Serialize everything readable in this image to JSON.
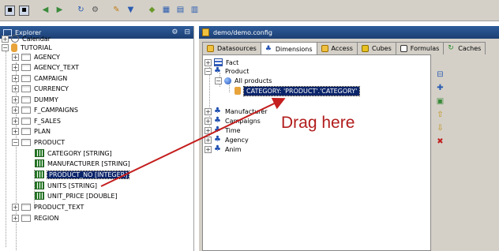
{
  "explorer": {
    "title": "Explorer",
    "tree": [
      {
        "label": "Calendar",
        "icon": "clock-icon"
      },
      {
        "label": "TUTORIAL",
        "icon": "database-icon"
      },
      {
        "label": "AGENCY",
        "icon": "table-icon"
      },
      {
        "label": "AGENCY_TEXT",
        "icon": "table-icon"
      },
      {
        "label": "CAMPAIGN",
        "icon": "table-icon"
      },
      {
        "label": "CURRENCY",
        "icon": "table-icon"
      },
      {
        "label": "DUMMY",
        "icon": "table-icon"
      },
      {
        "label": "F_CAMPAIGNS",
        "icon": "table-icon"
      },
      {
        "label": "F_SALES",
        "icon": "table-icon"
      },
      {
        "label": "PLAN",
        "icon": "table-icon"
      },
      {
        "label": "PRODUCT",
        "icon": "table-icon"
      },
      {
        "label": "CATEGORY [STRING]",
        "icon": "column-icon"
      },
      {
        "label": "MANUFACTURER [STRING]",
        "icon": "column-icon"
      },
      {
        "label": "PRODUCT_NO [INTEGER]",
        "icon": "column-icon",
        "selected": true
      },
      {
        "label": "UNITS [STRING]",
        "icon": "column-icon"
      },
      {
        "label": "UNIT_PRICE [DOUBLE]",
        "icon": "column-icon"
      },
      {
        "label": "PRODUCT_TEXT",
        "icon": "table-icon"
      },
      {
        "label": "REGION",
        "icon": "table-icon"
      }
    ]
  },
  "config": {
    "title": "demo/demo.config",
    "tabs": [
      {
        "label": "Datasources",
        "active": false
      },
      {
        "label": "Dimensions",
        "active": true
      },
      {
        "label": "Access",
        "active": false
      },
      {
        "label": "Cubes",
        "active": false
      },
      {
        "label": "Formulas",
        "active": false
      },
      {
        "label": "Caches",
        "active": false
      }
    ],
    "dimensions": [
      {
        "label": "Fact",
        "icon": "fact-icon"
      },
      {
        "label": "Product",
        "icon": "dimension-icon"
      },
      {
        "label": "All products",
        "icon": "hierarchy-icon"
      },
      {
        "label": "CATEGORY: 'PRODUCT'.'CATEGORY'",
        "icon": "level-icon",
        "selected": true
      },
      {
        "label": "Manufacturer",
        "icon": "dimension-icon"
      },
      {
        "label": "Campaigns",
        "icon": "dimension-icon"
      },
      {
        "label": "Time",
        "icon": "dimension-icon"
      },
      {
        "label": "Agency",
        "icon": "dimension-icon"
      },
      {
        "label": "Anim",
        "icon": "dimension-icon"
      }
    ]
  },
  "annotation": {
    "text": "Drag here"
  }
}
